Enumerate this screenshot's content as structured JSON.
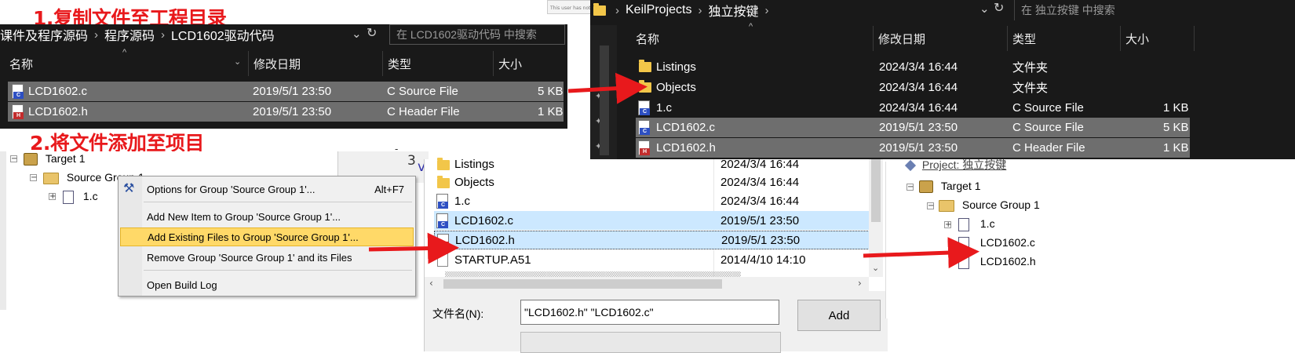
{
  "steps": {
    "step1": "1.复制文件至工程目录",
    "step2": "2.将文件添加至项目"
  },
  "note": "This user has not posted any comme",
  "source_explorer": {
    "breadcrumb": [
      "课件及程序源码",
      "程序源码",
      "LCD1602驱动代码"
    ],
    "search_placeholder": "在 LCD1602驱动代码 中搜索",
    "columns": [
      "名称",
      "修改日期",
      "类型",
      "大小"
    ],
    "files": [
      {
        "name": "LCD1602.c",
        "date": "2019/5/1 23:50",
        "type": "C Source File",
        "size": "5 KB",
        "icon": "c-source-icon",
        "badge": "C",
        "badge_color": "#2d4fc2"
      },
      {
        "name": "LCD1602.h",
        "date": "2019/5/1 23:50",
        "type": "C Header File",
        "size": "1 KB",
        "icon": "c-header-icon",
        "badge": "H",
        "badge_color": "#c22d2d"
      }
    ]
  },
  "dest_explorer": {
    "breadcrumb": [
      "KeilProjects",
      "独立按键"
    ],
    "search_placeholder": "在 独立按键 中搜索",
    "columns": [
      "名称",
      "修改日期",
      "类型",
      "大小"
    ],
    "files": [
      {
        "name": "Listings",
        "date": "2024/3/4 16:44",
        "type": "文件夹",
        "size": "",
        "kind": "folder"
      },
      {
        "name": "Objects",
        "date": "2024/3/4 16:44",
        "type": "文件夹",
        "size": "",
        "kind": "folder"
      },
      {
        "name": "1.c",
        "date": "2024/3/4 16:44",
        "type": "C Source File",
        "size": "1 KB",
        "kind": "c",
        "badge": "C",
        "badge_color": "#2d4fc2"
      },
      {
        "name": "LCD1602.c",
        "date": "2019/5/1 23:50",
        "type": "C Source File",
        "size": "5 KB",
        "kind": "c",
        "badge": "C",
        "badge_color": "#2d4fc2",
        "selected": true
      },
      {
        "name": "LCD1602.h",
        "date": "2019/5/1 23:50",
        "type": "C Header File",
        "size": "1 KB",
        "kind": "h",
        "badge": "H",
        "badge_color": "#c22d2d",
        "selected": true
      }
    ]
  },
  "keil_tree_left": {
    "target": "Target 1",
    "group": "Source Group 1",
    "file": "1.c",
    "editor_line": "3"
  },
  "context_menu": {
    "items": [
      {
        "label": "Options for Group 'Source Group 1'...",
        "shortcut": "Alt+F7"
      },
      {
        "label": "Add New  Item to Group 'Source Group 1'...",
        "shortcut": ""
      },
      {
        "label": "Add Existing Files to Group 'Source Group 1'...",
        "shortcut": "",
        "highlighted": true
      },
      {
        "label": "Remove Group 'Source Group 1' and its Files",
        "shortcut": ""
      },
      {
        "label": "Open Build Log",
        "shortcut": ""
      }
    ]
  },
  "open_dialog": {
    "files": [
      {
        "name": "Listings",
        "date": "2024/3/4 16:44",
        "kind": "folder"
      },
      {
        "name": "Objects",
        "date": "2024/3/4 16:44",
        "kind": "folder"
      },
      {
        "name": "1.c",
        "date": "2024/3/4 16:44",
        "kind": "c",
        "badge": "C",
        "badge_color": "#2d4fc2"
      },
      {
        "name": "LCD1602.c",
        "date": "2019/5/1 23:50",
        "kind": "c",
        "badge": "C",
        "badge_color": "#2d4fc2",
        "selected": true
      },
      {
        "name": "LCD1602.h",
        "date": "2019/5/1 23:50",
        "kind": "h",
        "badge": "H",
        "badge_color": "#c22d2d",
        "selected": true
      },
      {
        "name": "STARTUP.A51",
        "date": "2014/4/10 14:10",
        "kind": "plain"
      }
    ],
    "filename_label": "文件名(N):",
    "filename_value": "\"LCD1602.h\" \"LCD1602.c\"",
    "add_button": "Add"
  },
  "keil_tree_right": {
    "project": "Project: 独立按键",
    "target": "Target 1",
    "group": "Source Group 1",
    "files": [
      "1.c",
      "LCD1602.c",
      "LCD1602.h"
    ]
  },
  "colors": {
    "annotation_red": "#e8191c",
    "dark_bg": "#191919",
    "selection_gray": "#6e6e6e",
    "menu_highlight": "#ffd968",
    "dialog_selection": "#cce8ff"
  }
}
